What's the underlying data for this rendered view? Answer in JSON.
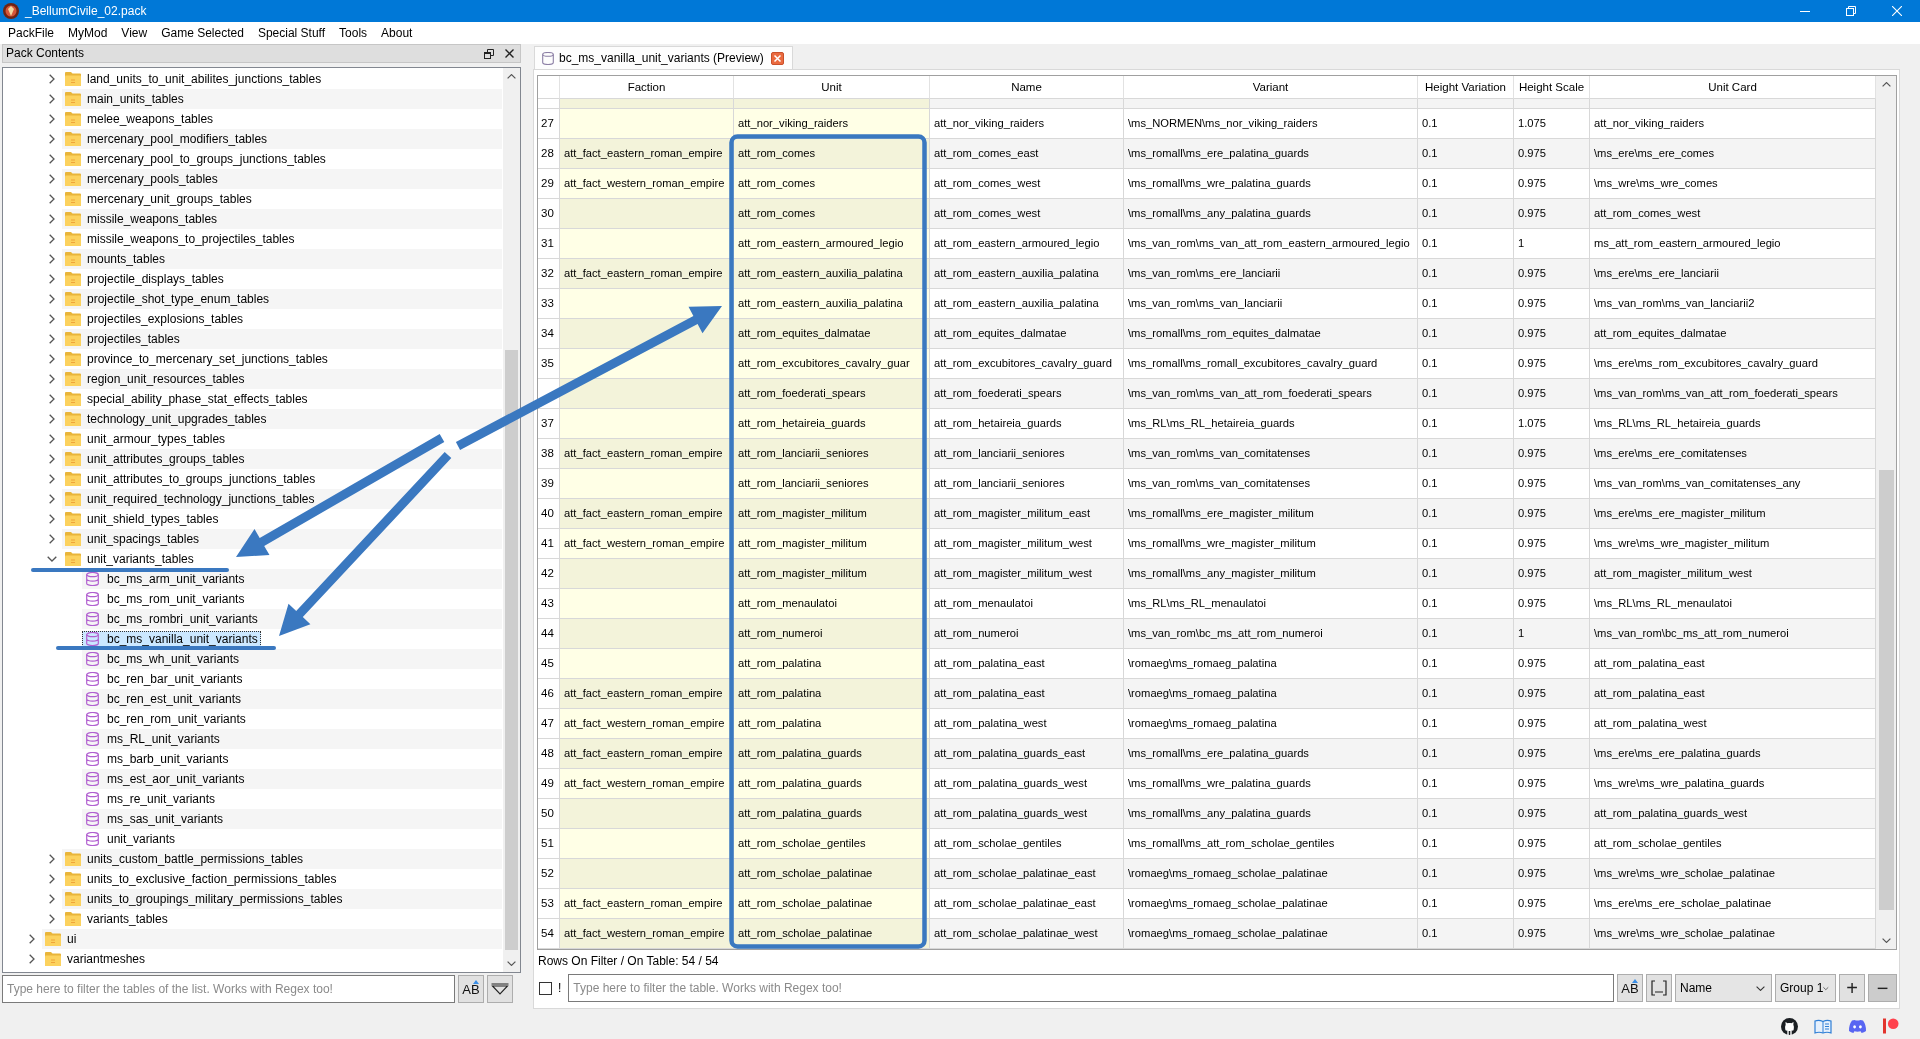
{
  "window": {
    "title": "_BellumCivile_02.pack"
  },
  "menu": [
    "PackFile",
    "MyMod",
    "View",
    "Game Selected",
    "Special Stuff",
    "Tools",
    "About"
  ],
  "pack_panel": {
    "title": "Pack Contents",
    "tree": [
      {
        "children": [
          {
            "label": "land_units_to_unit_abilites_junctions_tables",
            "kind": "folder",
            "expanded": false,
            "selected": false
          },
          {
            "label": "main_units_tables",
            "kind": "folder",
            "expanded": false,
            "selected": false
          },
          {
            "label": "melee_weapons_tables",
            "kind": "folder",
            "expanded": false,
            "selected": false
          },
          {
            "label": "mercenary_pool_modifiers_tables",
            "kind": "folder",
            "expanded": false,
            "selected": false
          },
          {
            "label": "mercenary_pool_to_groups_junctions_tables",
            "kind": "folder",
            "expanded": false,
            "selected": false
          },
          {
            "label": "mercenary_pools_tables",
            "kind": "folder",
            "expanded": false,
            "selected": false
          },
          {
            "label": "mercenary_unit_groups_tables",
            "kind": "folder",
            "expanded": false,
            "selected": false
          },
          {
            "label": "missile_weapons_tables",
            "kind": "folder",
            "expanded": false,
            "selected": false
          },
          {
            "label": "missile_weapons_to_projectiles_tables",
            "kind": "folder",
            "expanded": false,
            "selected": false
          },
          {
            "label": "mounts_tables",
            "kind": "folder",
            "expanded": false,
            "selected": false
          },
          {
            "label": "projectile_displays_tables",
            "kind": "folder",
            "expanded": false,
            "selected": false
          },
          {
            "label": "projectile_shot_type_enum_tables",
            "kind": "folder",
            "expanded": false,
            "selected": false
          },
          {
            "label": "projectiles_explosions_tables",
            "kind": "folder",
            "expanded": false,
            "selected": false
          },
          {
            "label": "projectiles_tables",
            "kind": "folder",
            "expanded": false,
            "selected": false
          },
          {
            "label": "province_to_mercenary_set_junctions_tables",
            "kind": "folder",
            "expanded": false,
            "selected": false
          },
          {
            "label": "region_unit_resources_tables",
            "kind": "folder",
            "expanded": false,
            "selected": false
          },
          {
            "label": "special_ability_phase_stat_effects_tables",
            "kind": "folder",
            "expanded": false,
            "selected": false
          },
          {
            "label": "technology_unit_upgrades_tables",
            "kind": "folder",
            "expanded": false,
            "selected": false
          },
          {
            "label": "unit_armour_types_tables",
            "kind": "folder",
            "expanded": false,
            "selected": false
          },
          {
            "label": "unit_attributes_groups_tables",
            "kind": "folder",
            "expanded": false,
            "selected": false
          },
          {
            "label": "unit_attributes_to_groups_junctions_tables",
            "kind": "folder",
            "expanded": false,
            "selected": false
          },
          {
            "label": "unit_required_technology_junctions_tables",
            "kind": "folder",
            "expanded": false,
            "selected": false
          },
          {
            "label": "unit_shield_types_tables",
            "kind": "folder",
            "expanded": false,
            "selected": false
          },
          {
            "label": "unit_spacings_tables",
            "kind": "folder",
            "expanded": false,
            "selected": false
          },
          {
            "label": "unit_variants_tables",
            "kind": "folder",
            "expanded": true,
            "selected": false,
            "children": [
              {
                "label": "bc_ms_arm_unit_variants",
                "kind": "table",
                "selected": false
              },
              {
                "label": "bc_ms_rom_unit_variants",
                "kind": "table",
                "selected": false
              },
              {
                "label": "bc_ms_rombri_unit_variants",
                "kind": "table",
                "selected": false
              },
              {
                "label": "bc_ms_vanilla_unit_variants",
                "kind": "table",
                "selected": true
              },
              {
                "label": "bc_ms_wh_unit_variants",
                "kind": "table",
                "selected": false
              },
              {
                "label": "bc_ren_bar_unit_variants",
                "kind": "table",
                "selected": false
              },
              {
                "label": "bc_ren_est_unit_variants",
                "kind": "table",
                "selected": false
              },
              {
                "label": "bc_ren_rom_unit_variants",
                "kind": "table",
                "selected": false
              },
              {
                "label": "ms_RL_unit_variants",
                "kind": "table",
                "selected": false
              },
              {
                "label": "ms_barb_unit_variants",
                "kind": "table",
                "selected": false
              },
              {
                "label": "ms_est_aor_unit_variants",
                "kind": "table",
                "selected": false
              },
              {
                "label": "ms_re_unit_variants",
                "kind": "table",
                "selected": false
              },
              {
                "label": "ms_sas_unit_variants",
                "kind": "table",
                "selected": false
              },
              {
                "label": "unit_variants",
                "kind": "table",
                "selected": false
              }
            ]
          },
          {
            "label": "units_custom_battle_permissions_tables",
            "kind": "folder",
            "expanded": false,
            "selected": false
          },
          {
            "label": "units_to_exclusive_faction_permissions_tables",
            "kind": "folder",
            "expanded": false,
            "selected": false
          },
          {
            "label": "units_to_groupings_military_permissions_tables",
            "kind": "folder",
            "expanded": false,
            "selected": false
          },
          {
            "label": "variants_tables",
            "kind": "folder",
            "expanded": false,
            "selected": false
          }
        ]
      },
      {
        "label": "ui",
        "kind": "folder",
        "expanded": false,
        "selected": false
      },
      {
        "label": "variantmeshes",
        "kind": "folder",
        "expanded": false,
        "selected": false
      }
    ],
    "filter": {
      "placeholder": "Type here to filter the tables of the list. Works with Regex too!",
      "case_button": "AB"
    }
  },
  "editor": {
    "tabs": [
      {
        "label": "bc_ms_vanilla_unit_variants (Preview)",
        "selected": true
      }
    ],
    "table": {
      "columns": [
        {
          "label": "Faction",
          "key_column": true
        },
        {
          "label": "Unit",
          "key_column": true
        },
        {
          "label": "Name",
          "key_column": false
        },
        {
          "label": "Variant",
          "key_column": false
        },
        {
          "label": "Height Variation",
          "key_column": false
        },
        {
          "label": "Height Scale",
          "key_column": false
        },
        {
          "label": "Unit Card",
          "key_column": false
        }
      ],
      "rows": [
        {
          "number": "27",
          "unit": "att_nor_viking_raiders",
          "name": "att_nor_viking_raiders",
          "variant": "\\ms_NORMEN\\ms_nor_viking_raiders",
          "height_variation": "0.1",
          "height_scale": "1.075",
          "unit_card": "att_nor_viking_raiders"
        },
        {
          "number": "28",
          "faction": "att_fact_eastern_roman_empire",
          "unit": "att_rom_comes",
          "name": "att_rom_comes_east",
          "variant": "\\ms_romall\\ms_ere_palatina_guards",
          "height_variation": "0.1",
          "height_scale": "0.975",
          "unit_card": "\\ms_ere\\ms_ere_comes"
        },
        {
          "number": "29",
          "faction": "att_fact_western_roman_empire",
          "unit": "att_rom_comes",
          "name": "att_rom_comes_west",
          "variant": "\\ms_romall\\ms_wre_palatina_guards",
          "height_variation": "0.1",
          "height_scale": "0.975",
          "unit_card": "\\ms_wre\\ms_wre_comes"
        },
        {
          "number": "30",
          "unit": "att_rom_comes",
          "name": "att_rom_comes_west",
          "variant": "\\ms_romall\\ms_any_palatina_guards",
          "height_variation": "0.1",
          "height_scale": "0.975",
          "unit_card": "att_rom_comes_west"
        },
        {
          "number": "31",
          "unit": "att_rom_eastern_armoured_legio",
          "name": "att_rom_eastern_armoured_legio",
          "variant": "\\ms_van_rom\\ms_van_att_rom_eastern_armoured_legio",
          "height_variation": "0.1",
          "height_scale": "1",
          "unit_card": "ms_att_rom_eastern_armoured_legio"
        },
        {
          "number": "32",
          "faction": "att_fact_eastern_roman_empire",
          "unit": "att_rom_eastern_auxilia_palatina",
          "name": "att_rom_eastern_auxilia_palatina",
          "variant": "\\ms_van_rom\\ms_ere_lanciarii",
          "height_variation": "0.1",
          "height_scale": "0.975",
          "unit_card": "\\ms_ere\\ms_ere_lanciarii"
        },
        {
          "number": "33",
          "unit": "att_rom_eastern_auxilia_palatina",
          "name": "att_rom_eastern_auxilia_palatina",
          "variant": "\\ms_van_rom\\ms_van_lanciarii",
          "height_variation": "0.1",
          "height_scale": "0.975",
          "unit_card": "\\ms_van_rom\\ms_van_lanciarii2"
        },
        {
          "number": "34",
          "unit": "att_rom_equites_dalmatae",
          "name": "att_rom_equites_dalmatae",
          "variant": "\\ms_romall\\ms_rom_equites_dalmatae",
          "height_variation": "0.1",
          "height_scale": "0.975",
          "unit_card": "att_rom_equites_dalmatae"
        },
        {
          "number": "35",
          "unit": "att_rom_excubitores_cavalry_guar",
          "name": "att_rom_excubitores_cavalry_guard",
          "variant": "\\ms_romall\\ms_romall_excubitores_cavalry_guard",
          "height_variation": "0.1",
          "height_scale": "0.975",
          "unit_card": "\\ms_ere\\ms_rom_excubitores_cavalry_guard"
        },
        {
          "unit": "att_rom_foederati_spears",
          "name": "att_rom_foederati_spears",
          "variant": "\\ms_van_rom\\ms_van_att_rom_foederati_spears",
          "height_variation": "0.1",
          "height_scale": "0.975",
          "unit_card": "\\ms_van_rom\\ms_van_att_rom_foederati_spears"
        },
        {
          "number": "37",
          "unit": "att_rom_hetaireia_guards",
          "name": "att_rom_hetaireia_guards",
          "variant": "\\ms_RL\\ms_RL_hetaireia_guards",
          "height_variation": "0.1",
          "height_scale": "1.075",
          "unit_card": "\\ms_RL\\ms_RL_hetaireia_guards"
        },
        {
          "number": "38",
          "faction": "att_fact_eastern_roman_empire",
          "unit": "att_rom_lanciarii_seniores",
          "name": "att_rom_lanciarii_seniores",
          "variant": "\\ms_van_rom\\ms_van_comitatenses",
          "height_variation": "0.1",
          "height_scale": "0.975",
          "unit_card": "\\ms_ere\\ms_ere_comitatenses"
        },
        {
          "number": "39",
          "unit": "att_rom_lanciarii_seniores",
          "name": "att_rom_lanciarii_seniores",
          "variant": "\\ms_van_rom\\ms_van_comitatenses",
          "height_variation": "0.1",
          "height_scale": "0.975",
          "unit_card": "\\ms_van_rom\\ms_van_comitatenses_any"
        },
        {
          "number": "40",
          "faction": "att_fact_eastern_roman_empire",
          "unit": "att_rom_magister_militum",
          "name": "att_rom_magister_militum_east",
          "variant": "\\ms_romall\\ms_ere_magister_militum",
          "height_variation": "0.1",
          "height_scale": "0.975",
          "unit_card": "\\ms_ere\\ms_ere_magister_militum"
        },
        {
          "number": "41",
          "faction": "att_fact_western_roman_empire",
          "unit": "att_rom_magister_militum",
          "name": "att_rom_magister_militum_west",
          "variant": "\\ms_romall\\ms_wre_magister_militum",
          "height_variation": "0.1",
          "height_scale": "0.975",
          "unit_card": "\\ms_wre\\ms_wre_magister_militum"
        },
        {
          "number": "42",
          "unit": "att_rom_magister_militum",
          "name": "att_rom_magister_militum_west",
          "variant": "\\ms_romall\\ms_any_magister_militum",
          "height_variation": "0.1",
          "height_scale": "0.975",
          "unit_card": "att_rom_magister_militum_west"
        },
        {
          "number": "43",
          "unit": "att_rom_menaulatoi",
          "name": "att_rom_menaulatoi",
          "variant": "\\ms_RL\\ms_RL_menaulatoi",
          "height_variation": "0.1",
          "height_scale": "0.975",
          "unit_card": "\\ms_RL\\ms_RL_menaulatoi"
        },
        {
          "number": "44",
          "unit": "att_rom_numeroi",
          "name": "att_rom_numeroi",
          "variant": "\\ms_van_rom\\bc_ms_att_rom_numeroi",
          "height_variation": "0.1",
          "height_scale": "1",
          "unit_card": "\\ms_van_rom\\bc_ms_att_rom_numeroi"
        },
        {
          "number": "45",
          "unit": "att_rom_palatina",
          "name": "att_rom_palatina_east",
          "variant": "\\romaeg\\ms_romaeg_palatina",
          "height_variation": "0.1",
          "height_scale": "0.975",
          "unit_card": "att_rom_palatina_east"
        },
        {
          "number": "46",
          "faction": "att_fact_eastern_roman_empire",
          "unit": "att_rom_palatina",
          "name": "att_rom_palatina_east",
          "variant": "\\romaeg\\ms_romaeg_palatina",
          "height_variation": "0.1",
          "height_scale": "0.975",
          "unit_card": "att_rom_palatina_east"
        },
        {
          "number": "47",
          "faction": "att_fact_western_roman_empire",
          "unit": "att_rom_palatina",
          "name": "att_rom_palatina_west",
          "variant": "\\romaeg\\ms_romaeg_palatina",
          "height_variation": "0.1",
          "height_scale": "0.975",
          "unit_card": "att_rom_palatina_west"
        },
        {
          "number": "48",
          "faction": "att_fact_eastern_roman_empire",
          "unit": "att_rom_palatina_guards",
          "name": "att_rom_palatina_guards_east",
          "variant": "\\ms_romall\\ms_ere_palatina_guards",
          "height_variation": "0.1",
          "height_scale": "0.975",
          "unit_card": "\\ms_ere\\ms_ere_palatina_guards"
        },
        {
          "number": "49",
          "faction": "att_fact_western_roman_empire",
          "unit": "att_rom_palatina_guards",
          "name": "att_rom_palatina_guards_west",
          "variant": "\\ms_romall\\ms_wre_palatina_guards",
          "height_variation": "0.1",
          "height_scale": "0.975",
          "unit_card": "\\ms_wre\\ms_wre_palatina_guards"
        },
        {
          "number": "50",
          "unit": "att_rom_palatina_guards",
          "name": "att_rom_palatina_guards_west",
          "variant": "\\ms_romall\\ms_any_palatina_guards",
          "height_variation": "0.1",
          "height_scale": "0.975",
          "unit_card": "att_rom_palatina_guards_west"
        },
        {
          "number": "51",
          "unit": "att_rom_scholae_gentiles",
          "name": "att_rom_scholae_gentiles",
          "variant": "\\ms_romall\\ms_att_rom_scholae_gentiles",
          "height_variation": "0.1",
          "height_scale": "0.975",
          "unit_card": "att_rom_scholae_gentiles"
        },
        {
          "number": "52",
          "unit": "att_rom_scholae_palatinae",
          "name": "att_rom_scholae_palatinae_east",
          "variant": "\\romaeg\\ms_romaeg_scholae_palatinae",
          "height_variation": "0.1",
          "height_scale": "0.975",
          "unit_card": "\\ms_wre\\ms_wre_scholae_palatinae"
        },
        {
          "number": "53",
          "faction": "att_fact_eastern_roman_empire",
          "unit": "att_rom_scholae_palatinae",
          "name": "att_rom_scholae_palatinae_east",
          "variant": "\\romaeg\\ms_romaeg_scholae_palatinae",
          "height_variation": "0.1",
          "height_scale": "0.975",
          "unit_card": "\\ms_ere\\ms_ere_scholae_palatinae"
        },
        {
          "number": "54",
          "faction": "att_fact_western_roman_empire",
          "unit": "att_rom_scholae_palatinae",
          "name": "att_rom_scholae_palatinae_west",
          "variant": "\\romaeg\\ms_romaeg_scholae_palatinae",
          "height_variation": "0.1",
          "height_scale": "0.975",
          "unit_card": "\\ms_wre\\ms_wre_scholae_palatinae"
        }
      ]
    },
    "row_count": "Rows On Filter / On Table: 54 / 54",
    "filter": {
      "invert_checked": false,
      "invert_label": "!",
      "placeholder": "Type here to filter the table. Works with Regex too!",
      "case_button": "AB",
      "column": "Name",
      "group": "Group 1",
      "add_button": "+",
      "remove_button": "−"
    }
  }
}
